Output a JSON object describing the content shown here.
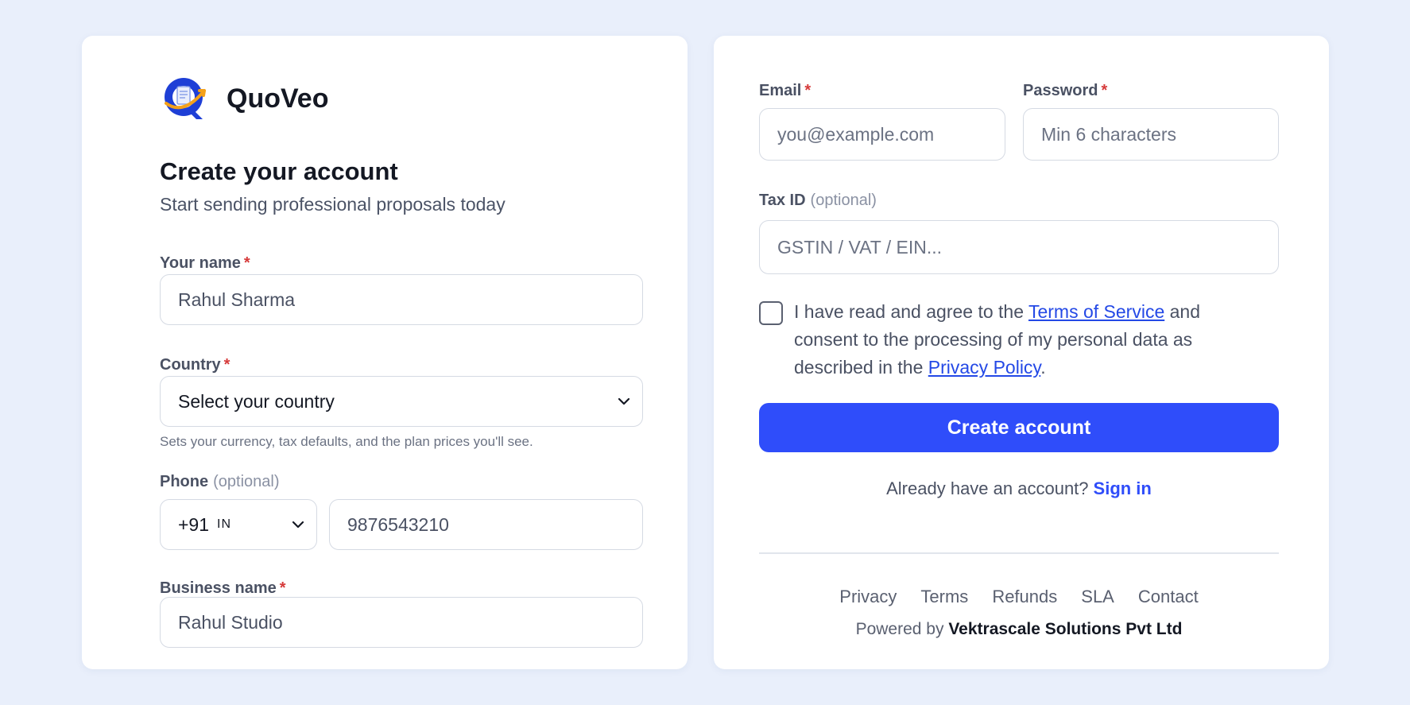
{
  "app": {
    "name": "QuoVeo"
  },
  "signup": {
    "title": "Create your account",
    "subtitle": "Start sending professional proposals today",
    "required_mark": "*",
    "name": {
      "label": "Your name",
      "value": "Rahul Sharma"
    },
    "country": {
      "label": "Country",
      "selected": "Select your country",
      "hint": "Sets your currency, tax defaults, and the plan prices you'll see."
    },
    "phone": {
      "label": "Phone",
      "optional": "(optional)",
      "code": "+91",
      "region": "IN",
      "value": "9876543210"
    },
    "business": {
      "label": "Business name",
      "value": "Rahul Studio"
    },
    "email": {
      "label": "Email",
      "placeholder": "you@example.com"
    },
    "password": {
      "label": "Password",
      "placeholder": "Min 6 characters"
    },
    "tax": {
      "label": "Tax ID",
      "optional": "(optional)",
      "placeholder": "GSTIN / VAT / EIN..."
    },
    "consent": {
      "text_1": "I have read and agree to the ",
      "terms_link": "Terms of Service",
      "text_2": " and consent to the processing of my personal data as described in the ",
      "privacy_link": "Privacy Policy",
      "text_3": "."
    },
    "submit_label": "Create account",
    "signin_prompt": "Already have an account?",
    "signin_link": "Sign in"
  },
  "footer": {
    "links": [
      "Privacy",
      "Terms",
      "Refunds",
      "SLA",
      "Contact"
    ],
    "powered_prefix": "Powered by",
    "company": "Vektrascale Solutions Pvt Ltd"
  },
  "colors": {
    "primary": "#2f4dfa",
    "link": "#2449e6",
    "required": "#d63a3a",
    "background": "#e9effb"
  },
  "icons": {
    "logo": "quoveo-logo-icon",
    "dropdown": "chevron-down-icon"
  }
}
